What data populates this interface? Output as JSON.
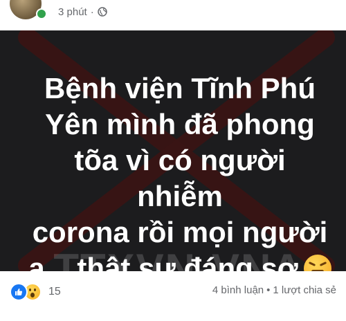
{
  "post": {
    "timestamp": "3 phút",
    "dot_separator": "·",
    "privacy_icon": "globe-icon",
    "text_lines": [
      "Bệnh viện Tĩnh Phú",
      "Yên mình đã phong",
      "tõa vì có người nhiễm",
      "corona rồi mọi người",
      "ạ... thật sự đáng sợ"
    ],
    "emoji": "tired-face-emoji",
    "watermark": "TTXVN-VNA",
    "overlay": "red-x-cross"
  },
  "reactions": {
    "icons": [
      "like-icon",
      "wow-icon"
    ],
    "count": "15"
  },
  "engagement": {
    "comments": "4 bình luận",
    "separator": "•",
    "shares": "1 lượt chia sẻ"
  },
  "colors": {
    "image_bg": "#1c1c1e",
    "cross": "#3a1414",
    "like_blue": "#1877f2",
    "meta_gray": "#65676b"
  }
}
